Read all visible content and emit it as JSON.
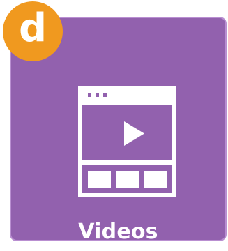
{
  "tile": {
    "label": "Videos",
    "background_color": "#9261ae",
    "icon": "video-player-icon"
  },
  "badge": {
    "letter": "d",
    "background_color": "#f0991f"
  },
  "colors": {
    "icon": "#ffffff",
    "text": "#ffffff"
  }
}
